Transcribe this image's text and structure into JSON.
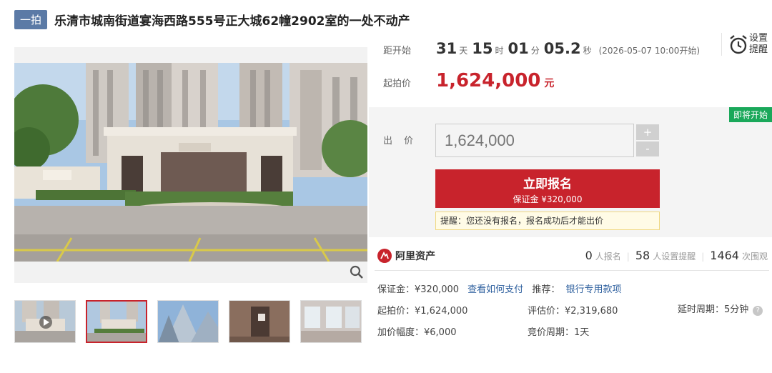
{
  "header": {
    "badge": "一拍",
    "title": "乐清市城南街道宴海西路555号正大城62幢2902室的一处不动产"
  },
  "countdown": {
    "label": "距开始",
    "days": "31",
    "days_unit": "天",
    "hours": "15",
    "hours_unit": "时",
    "minutes": "01",
    "minutes_unit": "分",
    "seconds": "05.2",
    "seconds_unit": "秒",
    "start_time": "(2026-05-07 10:00开始)"
  },
  "reminder": {
    "line1": "设置",
    "line2": "提醒"
  },
  "start_price": {
    "label": "起拍价",
    "value": "1,624,000",
    "unit": "元"
  },
  "bid": {
    "status_tag": "即将开始",
    "label": "出 价",
    "input_placeholder": "1,624,000",
    "plus": "+",
    "minus": "-",
    "signup_label": "立即报名",
    "deposit_label": "保证金 ¥320,000",
    "tip": "提醒：您还没有报名，报名成功后才能出价"
  },
  "platform": {
    "name": "阿里资产"
  },
  "stats": {
    "signups": "0",
    "signups_label": "人报名",
    "reminders": "58",
    "reminders_label": "人设置提醒",
    "views": "1464",
    "views_label": "次围观"
  },
  "details": {
    "deposit": "保证金：¥320,000",
    "pay_link": "查看如何支付",
    "recommend_label": "推荐：",
    "bank_link": "银行专用款项",
    "start_price": "起拍价：¥1,624,000",
    "appraisal": "评估价：¥2,319,680",
    "extend": "延时周期：5分钟",
    "increment": "加价幅度：¥6,000",
    "cycle": "竞价周期：1天"
  },
  "gallery": {
    "thumbnails": [
      "thumb-video",
      "thumb-entrance",
      "thumb-towers",
      "thumb-door",
      "thumb-interior"
    ],
    "active_index": 1
  },
  "colors": {
    "accent_red": "#c8232c",
    "badge_blue": "#5b7aa6",
    "link_blue": "#2d5f9e",
    "status_green": "#1aa85a"
  }
}
